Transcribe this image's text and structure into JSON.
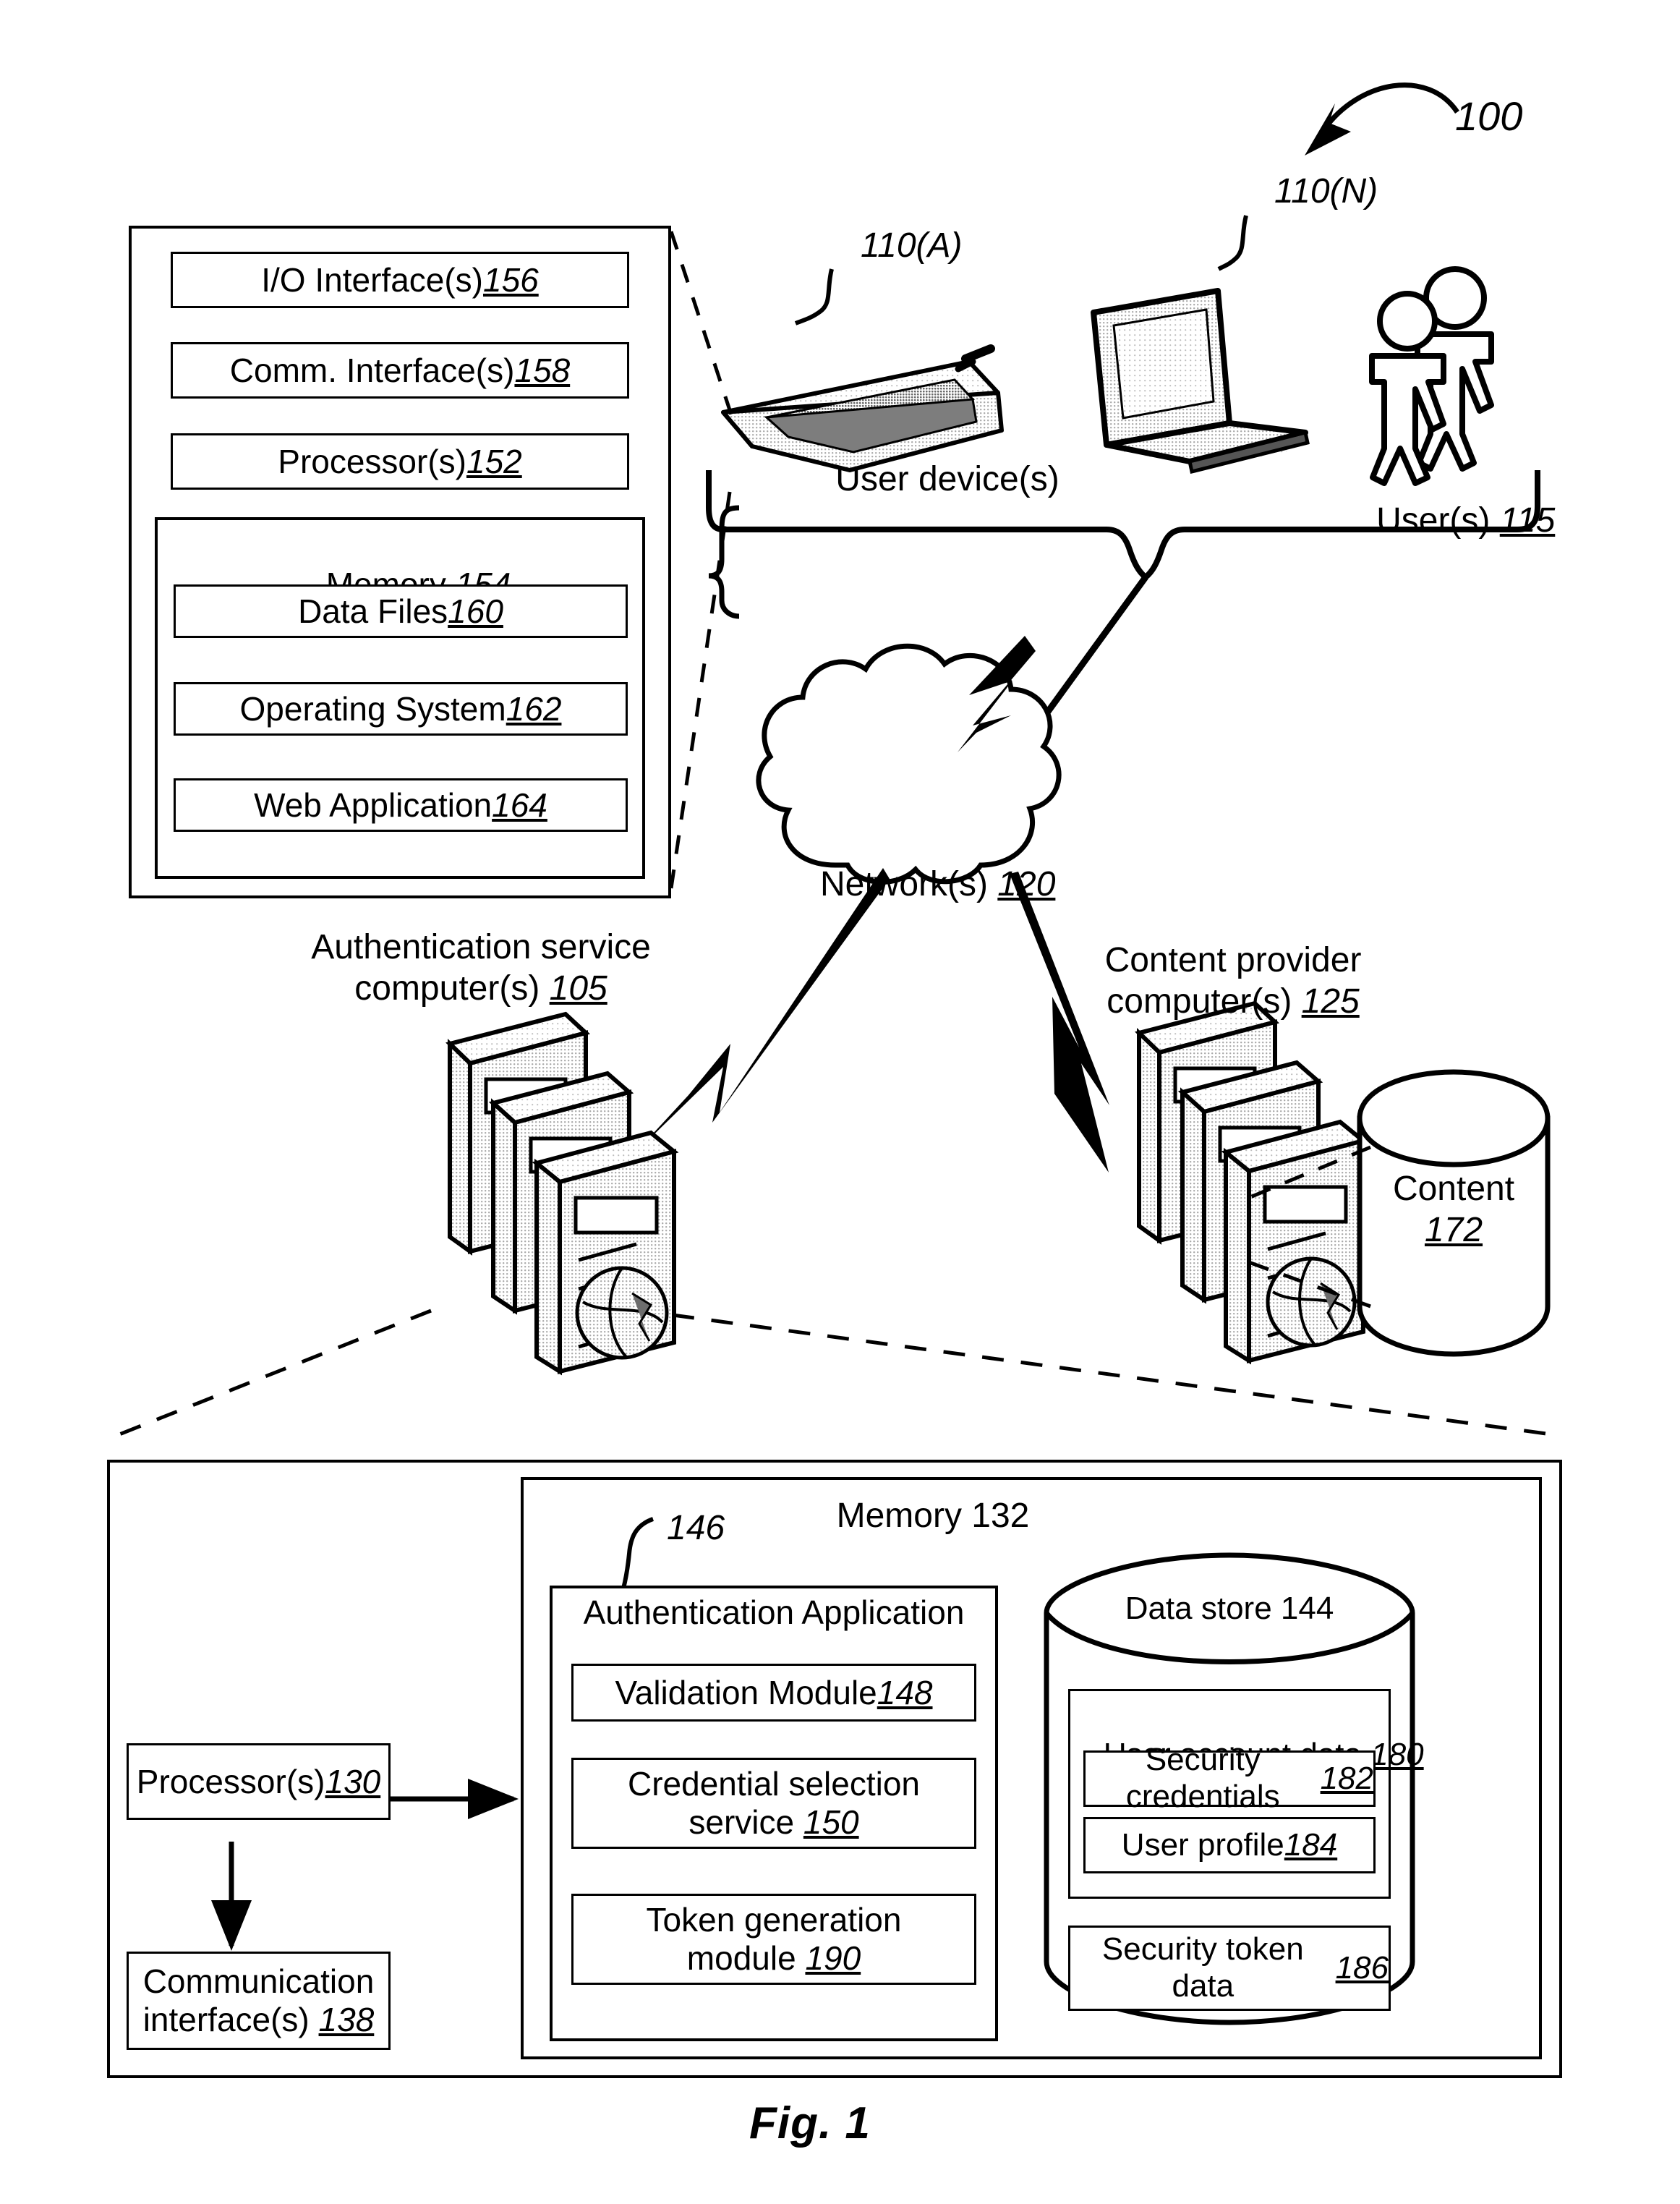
{
  "figure": {
    "caption": "Fig. 1",
    "system_ref": "100"
  },
  "user_device": {
    "ref_a": "110(A)",
    "ref_n": "110(N)",
    "devices_label": "User device(s)",
    "users_label": "User(s) ",
    "users_ref": "115",
    "components": [
      {
        "label": "I/O Interface(s) ",
        "ref": "156"
      },
      {
        "label": "Comm. Interface(s) ",
        "ref": "158"
      },
      {
        "label": "Processor(s) ",
        "ref": "152"
      }
    ],
    "memory": {
      "label": "Memory ",
      "ref": "154",
      "items": [
        {
          "label": "Data Files ",
          "ref": "160"
        },
        {
          "label": "Operating System ",
          "ref": "162"
        },
        {
          "label": "Web Application ",
          "ref": "164"
        }
      ]
    }
  },
  "network": {
    "label": "Network(s) ",
    "ref": "120"
  },
  "auth_service": {
    "line1": "Authentication service",
    "line2": "computer(s) ",
    "ref": "105"
  },
  "content_provider": {
    "line1": "Content provider",
    "line2": "computer(s) ",
    "ref": "125",
    "content_store": {
      "label": "Content",
      "ref": "172"
    }
  },
  "detail_panel": {
    "processor": {
      "label": "Processor(s) ",
      "ref": "130"
    },
    "comm_interface": {
      "line1": "Communication",
      "line2": "interface(s) ",
      "ref": "138"
    },
    "memory_title": "Memory 132",
    "app_ref": "146",
    "application": {
      "title": "Authentication Application",
      "modules": [
        {
          "line1": "Validation Module ",
          "line2": "",
          "ref": "148"
        },
        {
          "line1": "Credential selection",
          "line2": "service ",
          "ref": "150"
        },
        {
          "line1": "Token generation",
          "line2": "module ",
          "ref": "190"
        }
      ]
    },
    "data_store": {
      "title": "Data store 144",
      "user_account": {
        "label": "User account data ",
        "ref": "180"
      },
      "security_credentials": {
        "label": "Security credentials ",
        "ref": "182"
      },
      "user_profile": {
        "label": "User profile ",
        "ref": "184"
      },
      "security_token": {
        "label": "Security token data ",
        "ref": "186"
      }
    }
  }
}
